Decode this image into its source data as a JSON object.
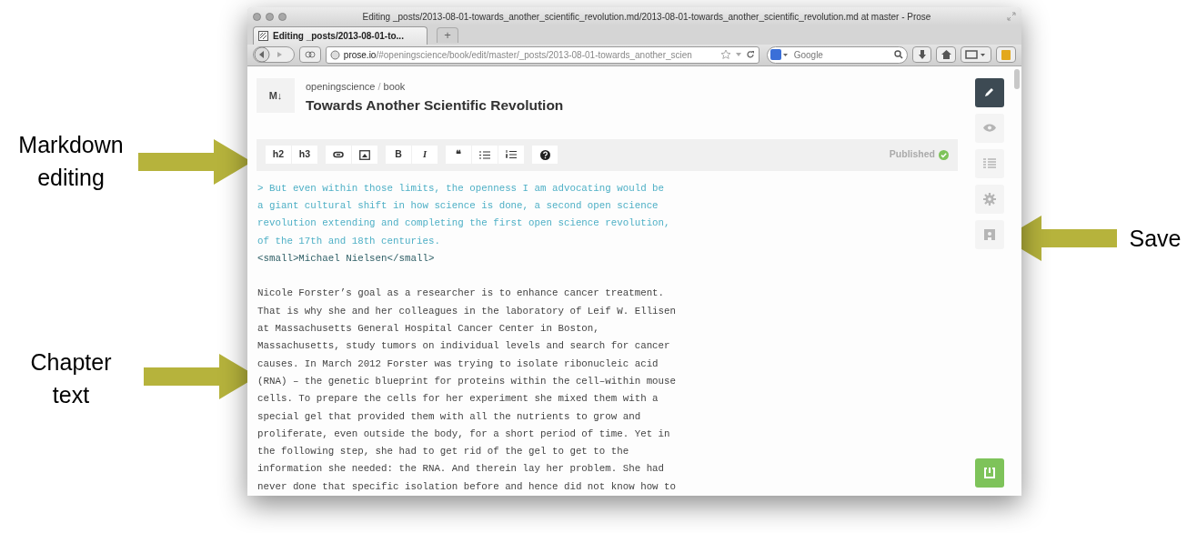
{
  "annotations": [
    {
      "label": "Markdown editing"
    },
    {
      "label": "Chapter text"
    },
    {
      "label": "Save"
    }
  ],
  "window": {
    "title": "Editing _posts/2013-08-01-towards_another_scientific_revolution.md/2013-08-01-towards_another_scientific_revolution.md at master - Prose"
  },
  "tabs": [
    {
      "label": "Editing _posts/2013-08-01-to...",
      "selected": true
    }
  ],
  "new_tab": "+",
  "address_bar": {
    "host": "prose.io",
    "path": "/#openingscience/book/edit/master/_posts/2013-08-01-towards_another_scien"
  },
  "search": {
    "placeholder": "Google"
  },
  "header": {
    "owner": "openingscience",
    "separator": "/",
    "repo": "book",
    "title": "Towards Another Scientific Revolution",
    "file_badge": "M↓"
  },
  "toolbar": {
    "groups": [
      [
        {
          "kind": "text",
          "label": "h2"
        },
        {
          "kind": "text",
          "label": "h3"
        }
      ],
      [
        {
          "kind": "icon"
        },
        {
          "kind": "icon"
        }
      ],
      [
        {
          "kind": "bold",
          "label": "B"
        },
        {
          "kind": "italic",
          "label": "I"
        }
      ],
      [
        {
          "kind": "text",
          "label": "❝"
        },
        {
          "kind": "icon"
        },
        {
          "kind": "icon"
        }
      ],
      [
        {
          "kind": "icon"
        }
      ]
    ],
    "status": "Published"
  },
  "editor_lines": [
    {
      "kind": "quote",
      "text": "> But even within those limits, the openness I am advocating would be"
    },
    {
      "kind": "quote",
      "text": "a giant cultural shift in how science is done, a second open science"
    },
    {
      "kind": "quote",
      "text": "revolution extending and completing the first open science revolution,"
    },
    {
      "kind": "quote",
      "text": "of the 17th and 18th centuries."
    },
    {
      "kind": "html",
      "text": "<small>Michael Nielsen</small>"
    },
    {
      "kind": "blank"
    },
    {
      "kind": "text",
      "text": "Nicole Forster’s goal as a researcher is to enhance cancer treatment."
    },
    {
      "kind": "text",
      "text": "That is why she and her colleagues in the laboratory of Leif W. Ellisen"
    },
    {
      "kind": "text",
      "text": "at Massachusetts General Hospital Cancer Center in Boston,"
    },
    {
      "kind": "text",
      "text": "Massachusetts, study tumors on individual levels and search for cancer"
    },
    {
      "kind": "text",
      "text": "causes. In March 2012 Forster was trying to isolate ribonucleic acid"
    },
    {
      "kind": "text",
      "text": "(RNA) – the genetic blueprint for proteins within the cell–within mouse"
    },
    {
      "kind": "text",
      "text": "cells. To prepare the cells for her experiment she mixed them with a"
    },
    {
      "kind": "text",
      "text": "special gel that provided them with all the nutrients to grow and"
    },
    {
      "kind": "text",
      "text": "proliferate, even outside the body, for a short period of time. Yet in"
    },
    {
      "kind": "text",
      "text": "the following step, she had to get rid of the gel to get to the"
    },
    {
      "kind": "text",
      "text": "information she needed: the RNA. And therein lay her problem. She had"
    },
    {
      "kind": "text",
      "text": "never done that specific isolation before and hence did not know how to"
    }
  ],
  "sidebar": [
    {
      "kind": "edit",
      "selected": true
    },
    {
      "kind": "preview",
      "selected": false
    },
    {
      "kind": "meta",
      "selected": false
    },
    {
      "kind": "settings",
      "selected": false
    },
    {
      "kind": "save",
      "selected": false
    }
  ]
}
